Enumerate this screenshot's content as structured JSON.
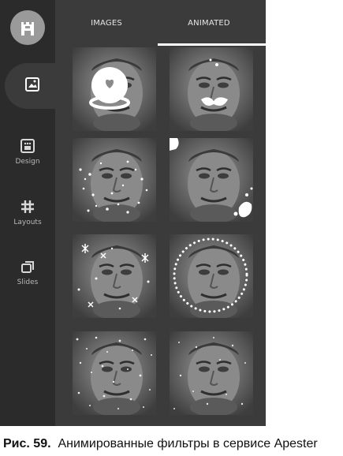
{
  "tabs": [
    {
      "label": "IMAGES",
      "active": false
    },
    {
      "label": "ANIMATED",
      "active": true
    }
  ],
  "sidebar": {
    "logo_icon": "apester-logo-icon",
    "items": [
      {
        "label": "",
        "icon": "image-icon",
        "active": true
      },
      {
        "label": "Design",
        "icon": "grid-dots-icon",
        "active": false
      },
      {
        "label": "Layouts",
        "icon": "hash-icon",
        "active": false
      },
      {
        "label": "Slides",
        "icon": "slides-icon",
        "active": false
      }
    ]
  },
  "grid": {
    "items": [
      {
        "filter": "heart-bubble"
      },
      {
        "filter": "mustache"
      },
      {
        "filter": "sparkle-burst"
      },
      {
        "filter": "paint-splash"
      },
      {
        "filter": "snowflakes"
      },
      {
        "filter": "dotted-circle"
      },
      {
        "filter": "snow-heavy"
      },
      {
        "filter": "snow-light"
      }
    ]
  },
  "caption": {
    "label": "Рис. 59.",
    "text": "Анимированные фильтры в сервисе Apester"
  },
  "colors": {
    "sidebar_bg": "#2b2b2b",
    "panel_bg": "#3b3b3b",
    "tab_text": "#e6e6e6",
    "active_underline": "#ffffff"
  }
}
